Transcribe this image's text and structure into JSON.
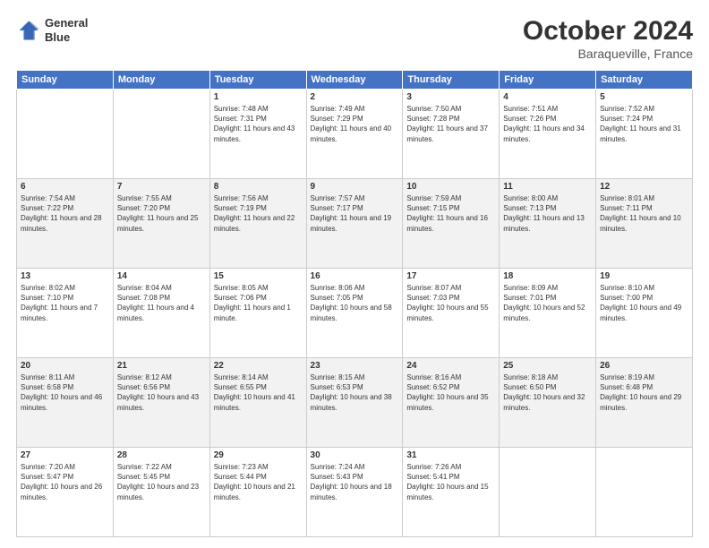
{
  "logo": {
    "line1": "General",
    "line2": "Blue"
  },
  "title": {
    "month": "October 2024",
    "location": "Baraqueville, France"
  },
  "header_days": [
    "Sunday",
    "Monday",
    "Tuesday",
    "Wednesday",
    "Thursday",
    "Friday",
    "Saturday"
  ],
  "weeks": [
    [
      {
        "day": null,
        "sunrise": null,
        "sunset": null,
        "daylight": null
      },
      {
        "day": null,
        "sunrise": null,
        "sunset": null,
        "daylight": null
      },
      {
        "day": "1",
        "sunrise": "Sunrise: 7:48 AM",
        "sunset": "Sunset: 7:31 PM",
        "daylight": "Daylight: 11 hours and 43 minutes."
      },
      {
        "day": "2",
        "sunrise": "Sunrise: 7:49 AM",
        "sunset": "Sunset: 7:29 PM",
        "daylight": "Daylight: 11 hours and 40 minutes."
      },
      {
        "day": "3",
        "sunrise": "Sunrise: 7:50 AM",
        "sunset": "Sunset: 7:28 PM",
        "daylight": "Daylight: 11 hours and 37 minutes."
      },
      {
        "day": "4",
        "sunrise": "Sunrise: 7:51 AM",
        "sunset": "Sunset: 7:26 PM",
        "daylight": "Daylight: 11 hours and 34 minutes."
      },
      {
        "day": "5",
        "sunrise": "Sunrise: 7:52 AM",
        "sunset": "Sunset: 7:24 PM",
        "daylight": "Daylight: 11 hours and 31 minutes."
      }
    ],
    [
      {
        "day": "6",
        "sunrise": "Sunrise: 7:54 AM",
        "sunset": "Sunset: 7:22 PM",
        "daylight": "Daylight: 11 hours and 28 minutes."
      },
      {
        "day": "7",
        "sunrise": "Sunrise: 7:55 AM",
        "sunset": "Sunset: 7:20 PM",
        "daylight": "Daylight: 11 hours and 25 minutes."
      },
      {
        "day": "8",
        "sunrise": "Sunrise: 7:56 AM",
        "sunset": "Sunset: 7:19 PM",
        "daylight": "Daylight: 11 hours and 22 minutes."
      },
      {
        "day": "9",
        "sunrise": "Sunrise: 7:57 AM",
        "sunset": "Sunset: 7:17 PM",
        "daylight": "Daylight: 11 hours and 19 minutes."
      },
      {
        "day": "10",
        "sunrise": "Sunrise: 7:59 AM",
        "sunset": "Sunset: 7:15 PM",
        "daylight": "Daylight: 11 hours and 16 minutes."
      },
      {
        "day": "11",
        "sunrise": "Sunrise: 8:00 AM",
        "sunset": "Sunset: 7:13 PM",
        "daylight": "Daylight: 11 hours and 13 minutes."
      },
      {
        "day": "12",
        "sunrise": "Sunrise: 8:01 AM",
        "sunset": "Sunset: 7:11 PM",
        "daylight": "Daylight: 11 hours and 10 minutes."
      }
    ],
    [
      {
        "day": "13",
        "sunrise": "Sunrise: 8:02 AM",
        "sunset": "Sunset: 7:10 PM",
        "daylight": "Daylight: 11 hours and 7 minutes."
      },
      {
        "day": "14",
        "sunrise": "Sunrise: 8:04 AM",
        "sunset": "Sunset: 7:08 PM",
        "daylight": "Daylight: 11 hours and 4 minutes."
      },
      {
        "day": "15",
        "sunrise": "Sunrise: 8:05 AM",
        "sunset": "Sunset: 7:06 PM",
        "daylight": "Daylight: 11 hours and 1 minute."
      },
      {
        "day": "16",
        "sunrise": "Sunrise: 8:06 AM",
        "sunset": "Sunset: 7:05 PM",
        "daylight": "Daylight: 10 hours and 58 minutes."
      },
      {
        "day": "17",
        "sunrise": "Sunrise: 8:07 AM",
        "sunset": "Sunset: 7:03 PM",
        "daylight": "Daylight: 10 hours and 55 minutes."
      },
      {
        "day": "18",
        "sunrise": "Sunrise: 8:09 AM",
        "sunset": "Sunset: 7:01 PM",
        "daylight": "Daylight: 10 hours and 52 minutes."
      },
      {
        "day": "19",
        "sunrise": "Sunrise: 8:10 AM",
        "sunset": "Sunset: 7:00 PM",
        "daylight": "Daylight: 10 hours and 49 minutes."
      }
    ],
    [
      {
        "day": "20",
        "sunrise": "Sunrise: 8:11 AM",
        "sunset": "Sunset: 6:58 PM",
        "daylight": "Daylight: 10 hours and 46 minutes."
      },
      {
        "day": "21",
        "sunrise": "Sunrise: 8:12 AM",
        "sunset": "Sunset: 6:56 PM",
        "daylight": "Daylight: 10 hours and 43 minutes."
      },
      {
        "day": "22",
        "sunrise": "Sunrise: 8:14 AM",
        "sunset": "Sunset: 6:55 PM",
        "daylight": "Daylight: 10 hours and 41 minutes."
      },
      {
        "day": "23",
        "sunrise": "Sunrise: 8:15 AM",
        "sunset": "Sunset: 6:53 PM",
        "daylight": "Daylight: 10 hours and 38 minutes."
      },
      {
        "day": "24",
        "sunrise": "Sunrise: 8:16 AM",
        "sunset": "Sunset: 6:52 PM",
        "daylight": "Daylight: 10 hours and 35 minutes."
      },
      {
        "day": "25",
        "sunrise": "Sunrise: 8:18 AM",
        "sunset": "Sunset: 6:50 PM",
        "daylight": "Daylight: 10 hours and 32 minutes."
      },
      {
        "day": "26",
        "sunrise": "Sunrise: 8:19 AM",
        "sunset": "Sunset: 6:48 PM",
        "daylight": "Daylight: 10 hours and 29 minutes."
      }
    ],
    [
      {
        "day": "27",
        "sunrise": "Sunrise: 7:20 AM",
        "sunset": "Sunset: 5:47 PM",
        "daylight": "Daylight: 10 hours and 26 minutes."
      },
      {
        "day": "28",
        "sunrise": "Sunrise: 7:22 AM",
        "sunset": "Sunset: 5:45 PM",
        "daylight": "Daylight: 10 hours and 23 minutes."
      },
      {
        "day": "29",
        "sunrise": "Sunrise: 7:23 AM",
        "sunset": "Sunset: 5:44 PM",
        "daylight": "Daylight: 10 hours and 21 minutes."
      },
      {
        "day": "30",
        "sunrise": "Sunrise: 7:24 AM",
        "sunset": "Sunset: 5:43 PM",
        "daylight": "Daylight: 10 hours and 18 minutes."
      },
      {
        "day": "31",
        "sunrise": "Sunrise: 7:26 AM",
        "sunset": "Sunset: 5:41 PM",
        "daylight": "Daylight: 10 hours and 15 minutes."
      },
      {
        "day": null,
        "sunrise": null,
        "sunset": null,
        "daylight": null
      },
      {
        "day": null,
        "sunrise": null,
        "sunset": null,
        "daylight": null
      }
    ]
  ]
}
